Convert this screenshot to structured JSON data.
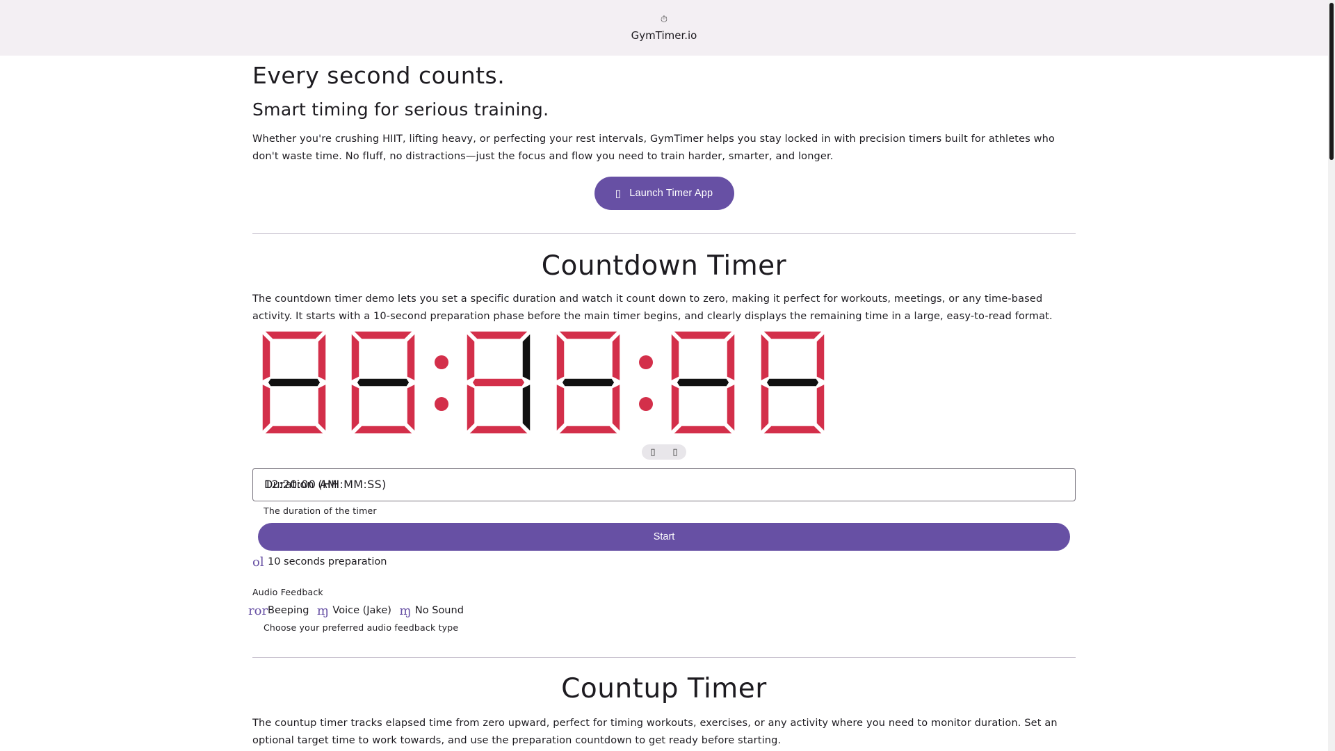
{
  "appbar": {
    "icon": "timer-icon",
    "title": "GymTimer.io"
  },
  "hero": {
    "title": "Every second counts.",
    "subtitle": "Smart timing for serious training.",
    "body": "Whether you're crushing HIIT, lifting heavy, or perfecting your rest intervals, GymTimer helps you stay locked in with precision timers built for athletes who don't waste time. No fluff, no distractions—just the focus and flow you need to train harder, smarter, and longer.",
    "launch_label": "Launch Timer App",
    "launch_icon": "rocket-icon"
  },
  "countdown": {
    "title": "Countdown Timer",
    "description": "The countdown timer demo lets you set a specific duration and watch it count down to zero, making it perfect for workouts, meetings, or any time-based activity. It starts with a 10-second preparation phase before the main timer begins, and clearly displays the remaining time in a large, easy-to-read format.",
    "display_digits": [
      "-",
      "-",
      "1",
      "-",
      "-",
      "-"
    ],
    "lit_color": "#d32f4a",
    "dark_color": "#111111",
    "toggle_left": "▯",
    "toggle_right": "▯",
    "duration_value": "12:20:00 AM",
    "duration_label": "Duration (HH:MM:SS)",
    "duration_helper": "The duration of the timer",
    "start_label": "Start",
    "prep_glyph": "ol",
    "prep_label": "10 seconds preparation",
    "audio_section": "Audio Feedback",
    "audio_options": [
      {
        "glyph": "ror",
        "label": "Beeping"
      },
      {
        "glyph": "ɱ",
        "label": "Voice (Jake)"
      },
      {
        "glyph": "ɱ",
        "label": "No Sound"
      }
    ],
    "audio_helper": "Choose your preferred audio feedback type"
  },
  "countup": {
    "title": "Countup Timer",
    "description": "The countup timer tracks elapsed time from zero upward, perfect for timing workouts, exercises, or any activity where you need to monitor duration. Set an optional target time to work towards, and use the preparation countdown to get ready before starting."
  }
}
